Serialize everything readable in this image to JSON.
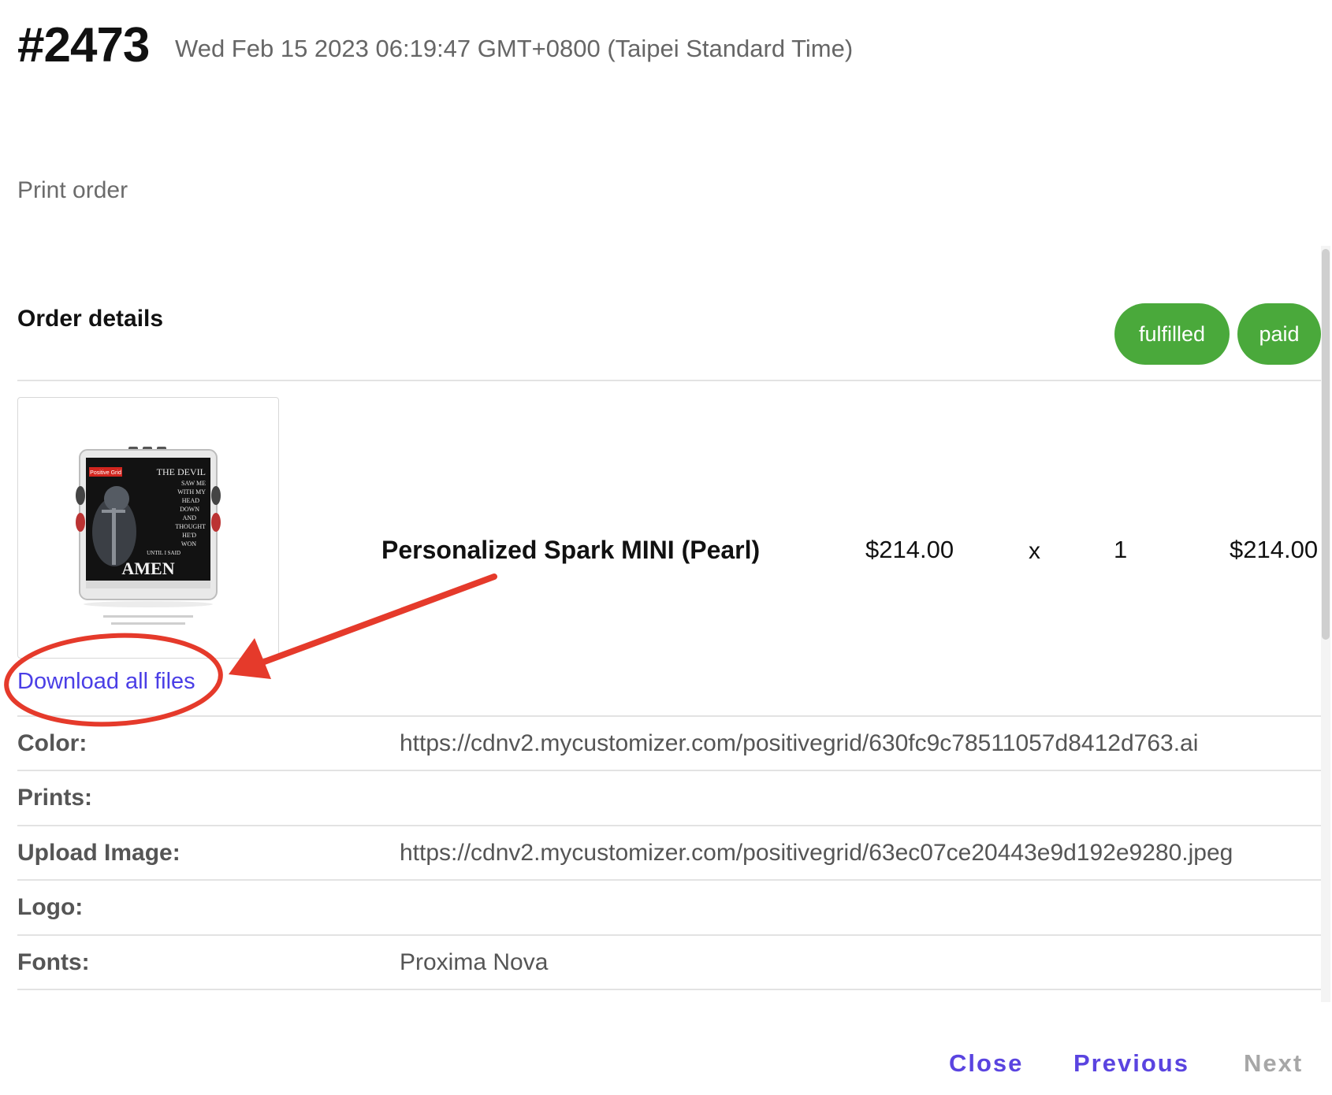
{
  "header": {
    "order_number": "#2473",
    "date": "Wed Feb 15 2023 06:19:47 GMT+0800 (Taipei Standard Time)"
  },
  "subtitle": "Print order",
  "order_details": {
    "title": "Order details",
    "badges": [
      {
        "label": "fulfilled",
        "color": "#4aa93b"
      },
      {
        "label": "paid",
        "color": "#4aa93b"
      }
    ]
  },
  "line_item": {
    "product_name": "Personalized Spark MINI (Pearl)",
    "unit_price": "$214.00",
    "times": "x",
    "quantity": "1",
    "total": "$214.00",
    "thumbnail": {
      "brand": "Positive Grid",
      "text_lines": [
        "THE DEVIL",
        "SAW ME",
        "WITH MY",
        "HEAD",
        "DOWN",
        "AND",
        "THOUGHT",
        "HE'D",
        "WON",
        "UNTIL I SAID"
      ],
      "big_word": "AMEN"
    },
    "download_label": "Download all files"
  },
  "attributes": [
    {
      "label": "Color:",
      "value": "https://cdnv2.mycustomizer.com/positivegrid/630fc9c78511057d8412d763.ai"
    },
    {
      "label": "Prints:",
      "value": ""
    },
    {
      "label": "Upload Image:",
      "value": "https://cdnv2.mycustomizer.com/positivegrid/63ec07ce20443e9d192e9280.jpeg"
    },
    {
      "label": "Logo:",
      "value": ""
    },
    {
      "label": "Fonts:",
      "value": "Proxima Nova"
    }
  ],
  "footer": {
    "close_label": "Close",
    "previous_label": "Previous",
    "next_label": "Next"
  },
  "colors": {
    "accent": "#5a44e0",
    "link": "#4a3ee6",
    "badge_green": "#4aa93b",
    "annotation_red": "#e53a2b",
    "disabled": "#a7a7a7"
  }
}
